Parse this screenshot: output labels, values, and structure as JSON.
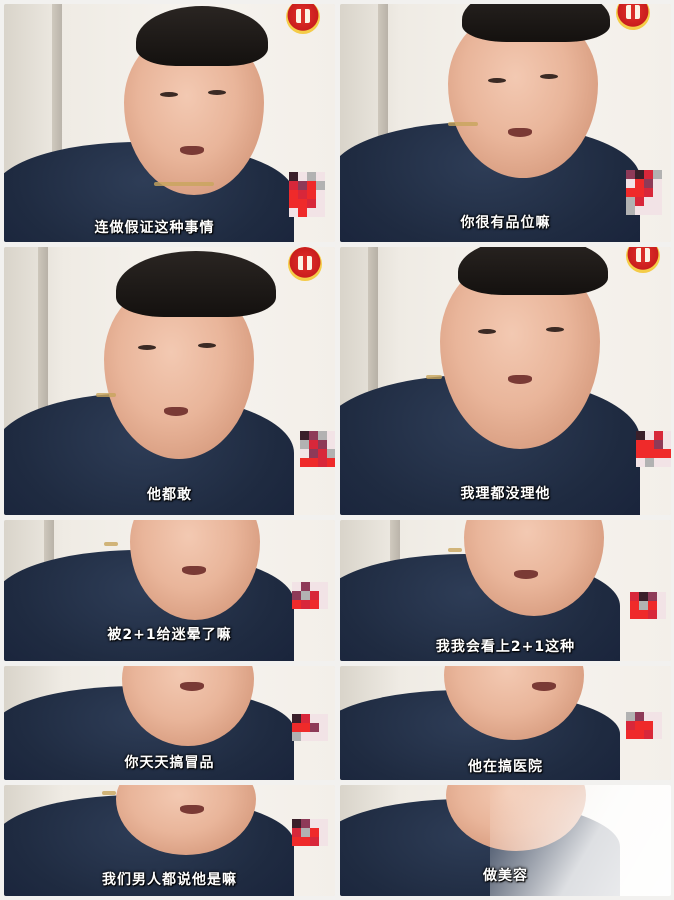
{
  "panels": [
    {
      "caption": "连做假证这种事情"
    },
    {
      "caption": "你很有品位嘛"
    },
    {
      "caption": "他都敢"
    },
    {
      "caption": "我理都没理他"
    },
    {
      "caption": "被2+1给迷晕了嘛"
    },
    {
      "caption": "我我会看上2+1这种"
    },
    {
      "caption": "你天天搞冒品"
    },
    {
      "caption": "他在搞医院"
    },
    {
      "caption": "我们男人都说他是嘛"
    },
    {
      "caption": "做美容"
    }
  ],
  "colors": {
    "shirt": "#1f2b41",
    "caption_text": "#ffffff",
    "gift_badge": "#c91d1d",
    "mosaic": [
      "#d8273a",
      "#3a1f2a",
      "#b2b2b2",
      "#f2e3e6",
      "#8e3a58",
      "#ef2a2a"
    ]
  },
  "icons": {
    "gift_badge": "red-gift-badge-icon",
    "mosaic": "pixelated-mosaic-icon"
  }
}
